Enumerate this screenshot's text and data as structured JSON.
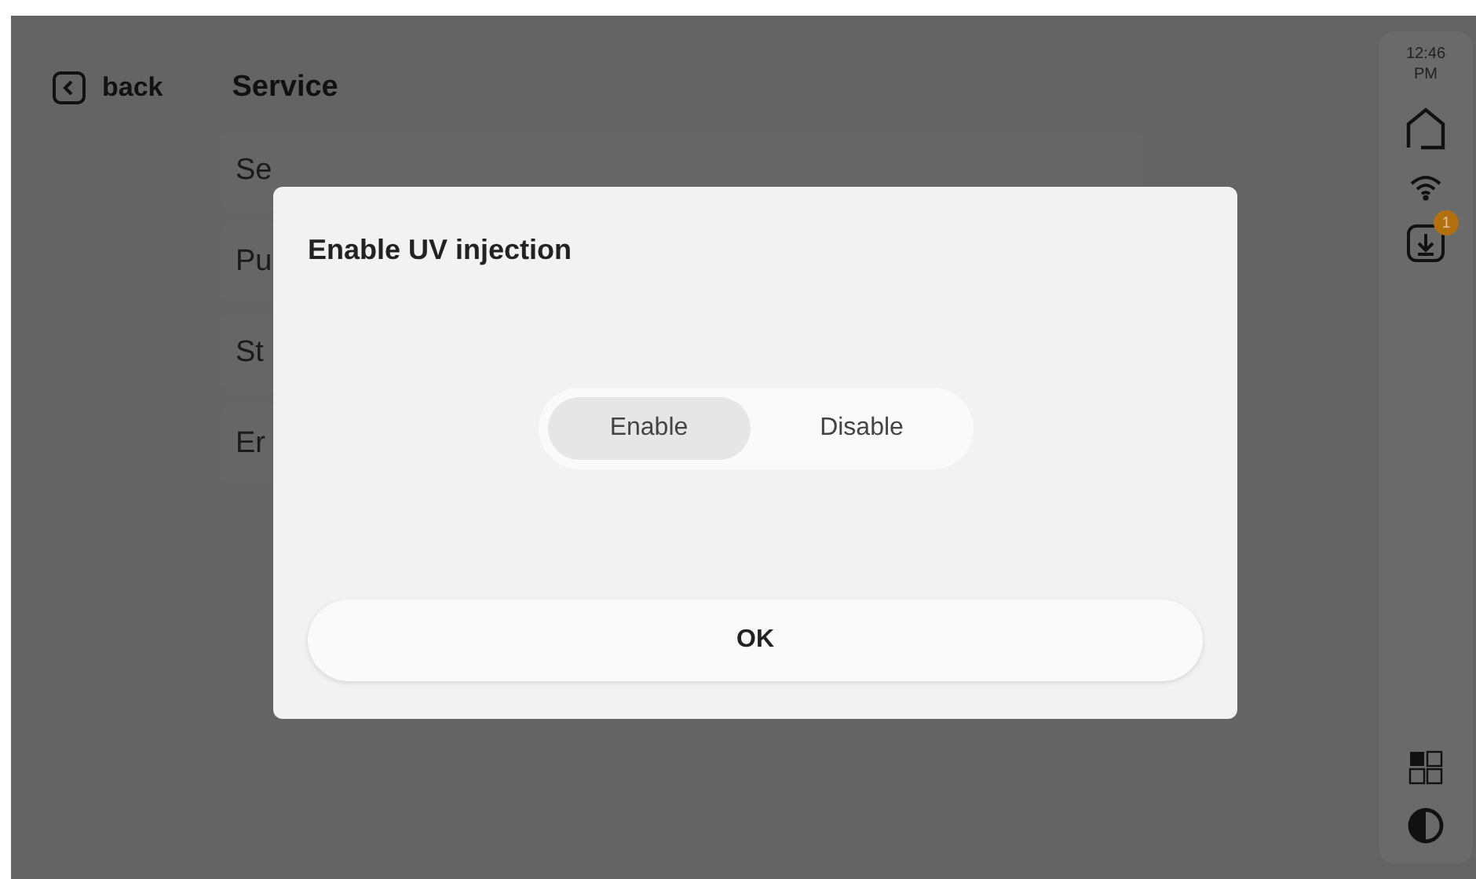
{
  "header": {
    "back_label": "back",
    "title": "Service"
  },
  "menu_items": [
    {
      "label": "Se"
    },
    {
      "label": "Pu"
    },
    {
      "label": "St"
    },
    {
      "label": "Er"
    }
  ],
  "sidebar": {
    "time": "12:46",
    "ampm": "PM",
    "notification_count": "1"
  },
  "dialog": {
    "title": "Enable UV injection",
    "options": [
      {
        "label": "Enable",
        "selected": true
      },
      {
        "label": "Disable",
        "selected": false
      }
    ],
    "ok_label": "OK"
  }
}
